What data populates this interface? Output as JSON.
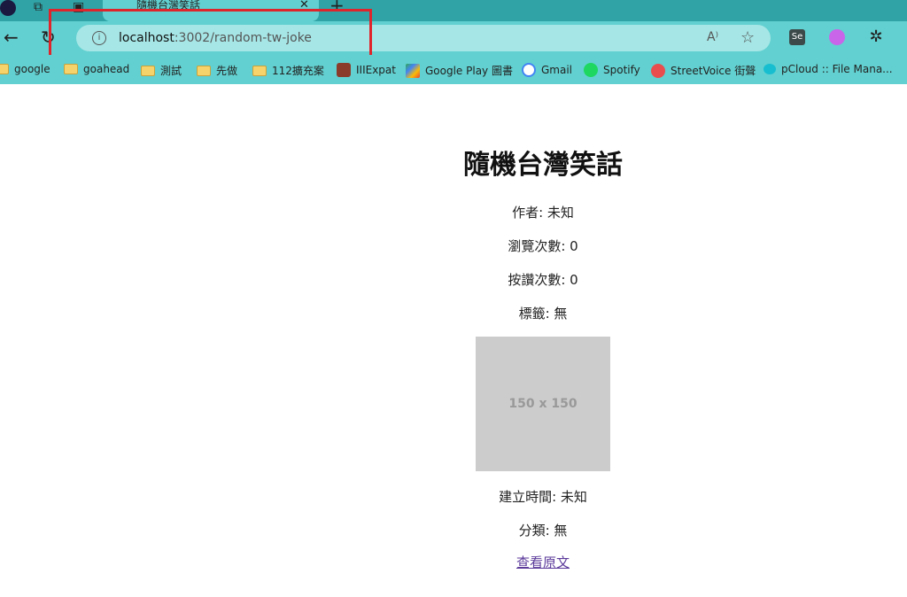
{
  "browser": {
    "tab_title": "隨機台灣笑話",
    "url_host": "localhost",
    "url_path": ":3002/random-tw-joke",
    "bookmarks": [
      "google",
      "goahead",
      "測試",
      "先做",
      "112擴充案",
      "IIIExpat",
      "Google Play 圖書",
      "Gmail",
      "Spotify",
      "StreetVoice 街聲",
      "pCloud :: File Mana..."
    ],
    "extension_label": "Se",
    "highlight_color": "#e0242b"
  },
  "page": {
    "title": "隨機台灣笑話",
    "author": "作者: 未知",
    "views": "瀏覽次數: 0",
    "likes": "按讚次數: 0",
    "tags": "標籤: 無",
    "image_placeholder": "150 x 150",
    "created": "建立時間: 未知",
    "category": "分類: 無",
    "source_link": "查看原文"
  }
}
